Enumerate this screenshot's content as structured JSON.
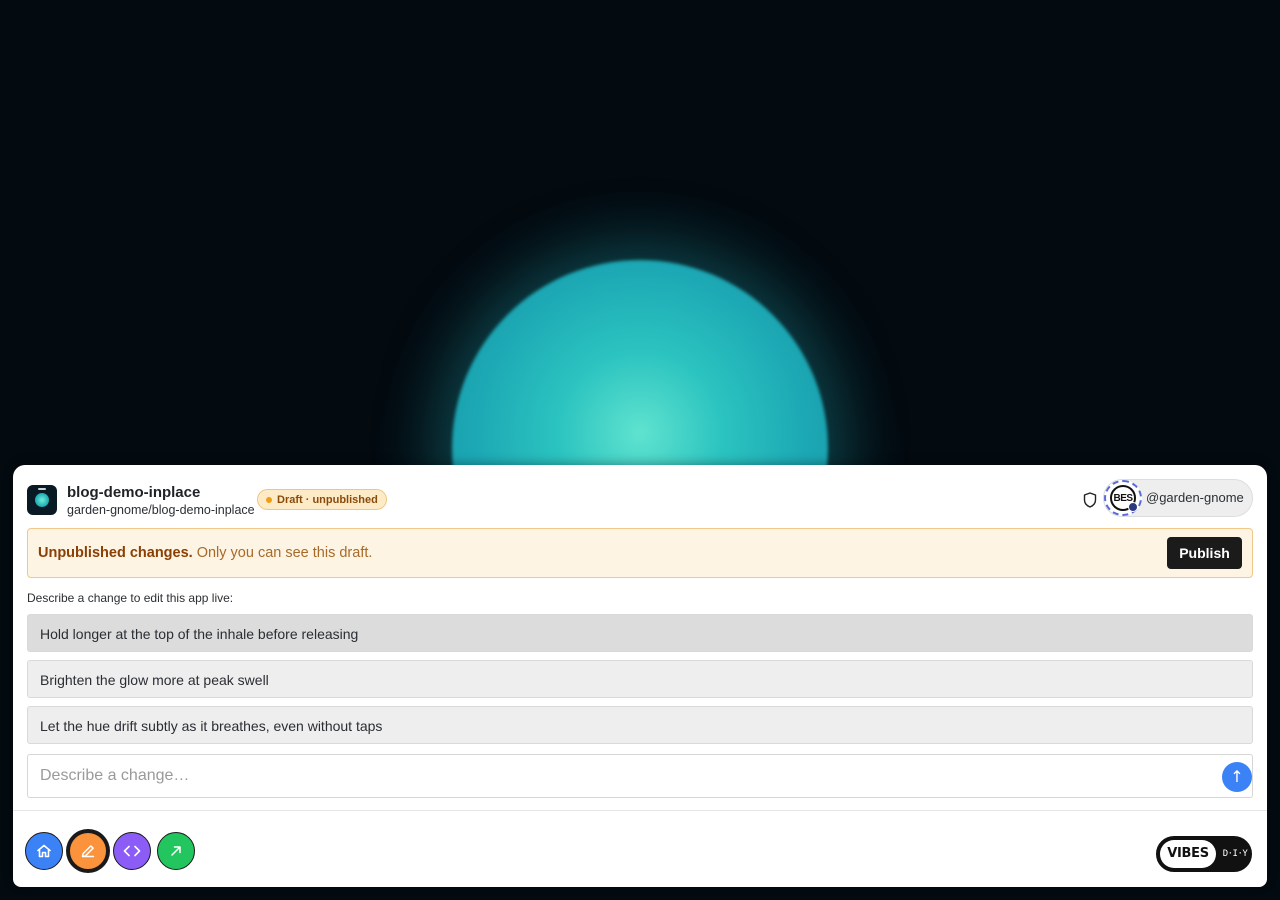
{
  "app": {
    "name": "blog-demo-inplace",
    "path": "garden-gnome/blog-demo-inplace",
    "status_badge": "Draft · unpublished"
  },
  "user": {
    "handle": "@garden-gnome",
    "avatar_text": "BES"
  },
  "notice": {
    "bold": "Unpublished changes.",
    "text": " Only you can see this draft.",
    "publish_label": "Publish"
  },
  "editor": {
    "label": "Describe a change to edit this app live:",
    "suggestions": [
      "Hold longer at the top of the inhale before releasing",
      "Brighten the glow more at peak swell",
      "Let the hue drift subtly as it breathes, even without taps"
    ],
    "input_placeholder": "Describe a change…",
    "send_glyph": "↑"
  },
  "nav": {
    "buttons": [
      {
        "icon": "home-icon",
        "color": "#3b82f6"
      },
      {
        "icon": "pencil-icon",
        "color": "#fb923c",
        "active": true
      },
      {
        "icon": "code-icon",
        "color": "#8b5cf6"
      },
      {
        "icon": "external-link-icon",
        "color": "#22c55e"
      }
    ]
  },
  "brand": {
    "left": "VIBES",
    "right": "D·I·Y"
  },
  "colors": {
    "orb": "#2bc3c0",
    "background": "#030a10",
    "publish_button": "#1b1b1b",
    "send_button": "#3b82f6"
  }
}
